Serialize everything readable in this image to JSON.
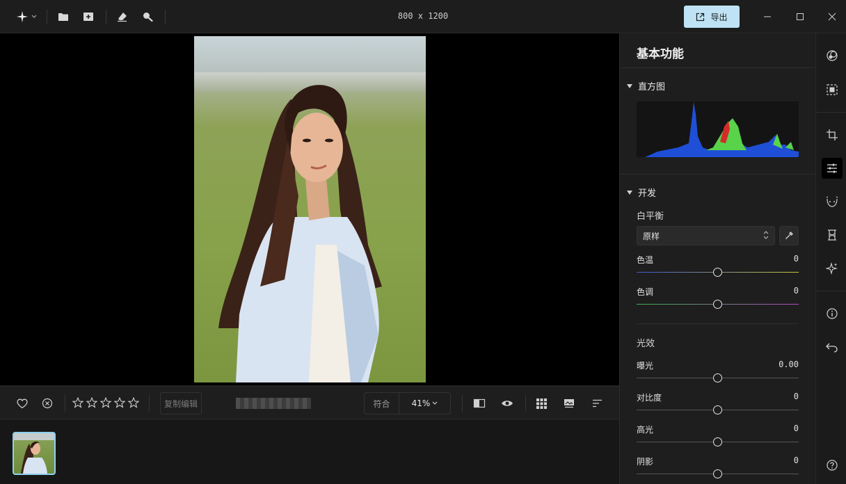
{
  "window": {
    "title": "800 x 1200",
    "export_label": "导出"
  },
  "bottombar": {
    "copy_edit_label": "复制编辑",
    "zoom_fit_label": "符合",
    "zoom_value": "41%",
    "rating": 0
  },
  "panel": {
    "title": "基本功能",
    "histogram": {
      "title": "直方图"
    },
    "develop": {
      "title": "开发",
      "white_balance": {
        "label": "白平衡",
        "preset": "原样"
      },
      "temp": {
        "label": "色温",
        "value": "0"
      },
      "tint": {
        "label": "色调",
        "value": "0"
      }
    },
    "light": {
      "title": "光效",
      "exposure": {
        "label": "曝光",
        "value": "0.00"
      },
      "contrast": {
        "label": "对比度",
        "value": "0"
      },
      "highlights": {
        "label": "高光",
        "value": "0"
      },
      "shadows": {
        "label": "阴影",
        "value": "0"
      }
    }
  },
  "colors": {
    "accent": "#bfe3f5",
    "thumb_border": "#8fd0ef",
    "histo_blue": "#1f4fd6",
    "histo_green": "#58d34a",
    "histo_red": "#d62a2a"
  }
}
